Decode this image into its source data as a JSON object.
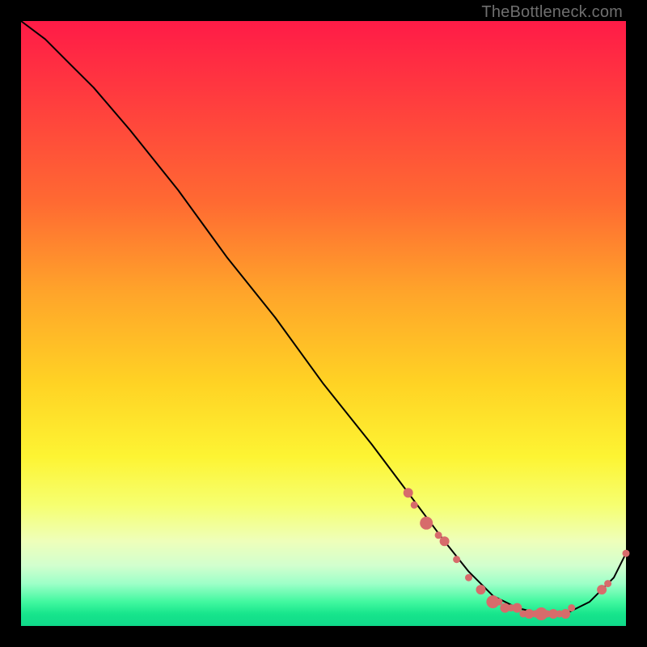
{
  "watermark": "TheBottleneck.com",
  "chart_data": {
    "type": "line",
    "title": "",
    "xlabel": "",
    "ylabel": "",
    "xlim": [
      0,
      100
    ],
    "ylim": [
      0,
      100
    ],
    "grid": false,
    "legend": false,
    "series": [
      {
        "name": "curve",
        "x": [
          0,
          4,
          8,
          12,
          18,
          26,
          34,
          42,
          50,
          58,
          64,
          70,
          74,
          78,
          82,
          86,
          90,
          94,
          98,
          100
        ],
        "y": [
          100,
          97,
          93,
          89,
          82,
          72,
          61,
          51,
          40,
          30,
          22,
          14,
          9,
          5,
          3,
          2,
          2,
          4,
          8,
          12
        ]
      }
    ],
    "markers": {
      "name": "highlight-dots",
      "color": "#d76b6b",
      "points": [
        {
          "x": 64,
          "y": 22,
          "size": "med"
        },
        {
          "x": 65,
          "y": 20,
          "size": "small"
        },
        {
          "x": 67,
          "y": 17,
          "size": "big"
        },
        {
          "x": 69,
          "y": 15,
          "size": "small"
        },
        {
          "x": 70,
          "y": 14,
          "size": "med"
        },
        {
          "x": 72,
          "y": 11,
          "size": "small"
        },
        {
          "x": 74,
          "y": 8,
          "size": "small"
        },
        {
          "x": 76,
          "y": 6,
          "size": "med"
        },
        {
          "x": 78,
          "y": 4,
          "size": "big"
        },
        {
          "x": 79,
          "y": 4,
          "size": "small"
        },
        {
          "x": 80,
          "y": 3,
          "size": "med"
        },
        {
          "x": 81,
          "y": 3,
          "size": "small"
        },
        {
          "x": 82,
          "y": 3,
          "size": "med"
        },
        {
          "x": 83,
          "y": 2,
          "size": "small"
        },
        {
          "x": 84,
          "y": 2,
          "size": "med"
        },
        {
          "x": 85,
          "y": 2,
          "size": "small"
        },
        {
          "x": 86,
          "y": 2,
          "size": "big"
        },
        {
          "x": 87,
          "y": 2,
          "size": "small"
        },
        {
          "x": 88,
          "y": 2,
          "size": "med"
        },
        {
          "x": 89,
          "y": 2,
          "size": "small"
        },
        {
          "x": 90,
          "y": 2,
          "size": "med"
        },
        {
          "x": 91,
          "y": 3,
          "size": "small"
        },
        {
          "x": 96,
          "y": 6,
          "size": "med"
        },
        {
          "x": 97,
          "y": 7,
          "size": "small"
        },
        {
          "x": 100,
          "y": 12,
          "size": "small"
        }
      ]
    }
  }
}
